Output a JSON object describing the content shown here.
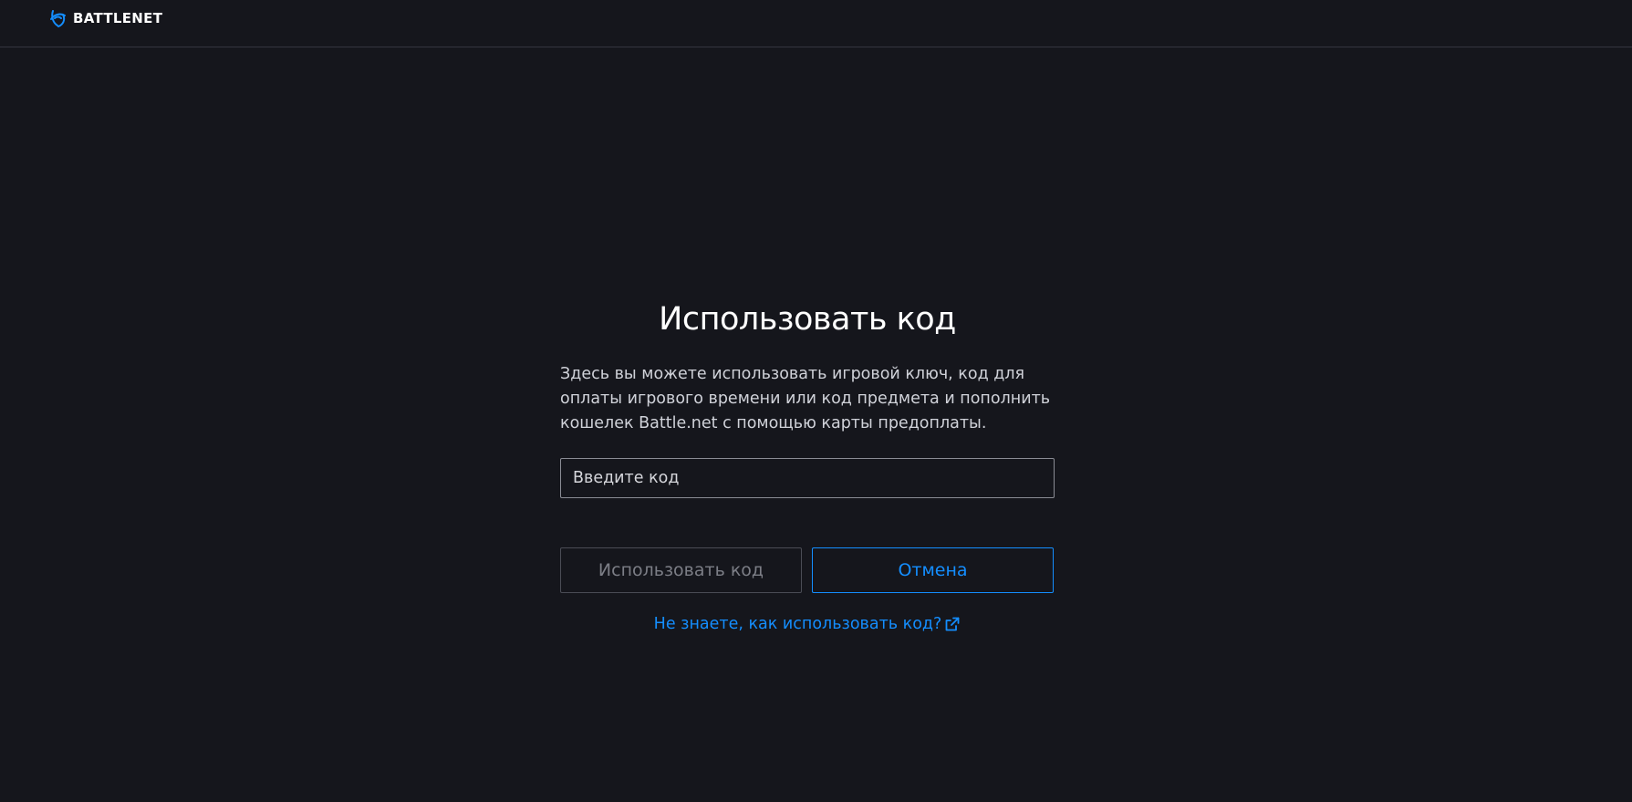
{
  "header": {
    "logo_text": "BATTLENET",
    "logo_icon": "battlenet-logo-icon",
    "accent_color": "#148eff"
  },
  "main": {
    "title": "Использовать код",
    "description": "Здесь вы можете использовать игровой ключ, код для оплаты игрового времени или код предмета и пополнить кошелек Battle.net с помощью карты предоплаты.",
    "code_input": {
      "placeholder": "Введите код",
      "value": ""
    },
    "redeem_button_label": "Использовать код",
    "cancel_button_label": "Отмена",
    "help_link_text": "Не знаете, как использовать код?",
    "help_link_icon": "external-link-icon"
  }
}
